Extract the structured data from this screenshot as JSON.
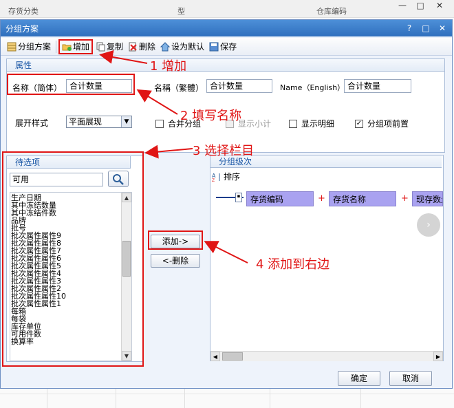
{
  "background": {
    "columns": [
      "存货分类",
      "型",
      "仓库编码"
    ],
    "window_buttons": [
      "—",
      "□",
      "✕"
    ]
  },
  "dialog": {
    "title": "分组方案",
    "title_buttons": [
      "?",
      "□",
      "✕"
    ]
  },
  "toolbar": {
    "scheme": "分组方案",
    "add": "增加",
    "copy": "复制",
    "delete": "删除",
    "set_default": "设为默认",
    "save": "保存"
  },
  "properties": {
    "tab": "属性",
    "name_simplified_label": "名称（简体）",
    "name_simplified_value": "合计数量",
    "name_traditional_label": "名稱（繁體）",
    "name_traditional_value": "合计数量",
    "name_english_label": "Name（English）",
    "name_english_value": "合计数量",
    "expand_style_label": "展开样式",
    "expand_style_value": "平面展现",
    "checkboxes": [
      {
        "label": "合并分组",
        "checked": false,
        "disabled": false
      },
      {
        "label": "显示小计",
        "checked": false,
        "disabled": true
      },
      {
        "label": "显示明细",
        "checked": false,
        "disabled": false
      },
      {
        "label": "分组项前置",
        "checked": true,
        "disabled": false
      }
    ]
  },
  "candidates": {
    "tab": "待选项",
    "search_value": "可用",
    "items": [
      "生产日期",
      "其中冻结数量",
      "其中冻结件数",
      "品牌",
      "批号",
      "批次属性属性9",
      "批次属性属性8",
      "批次属性属性7",
      "批次属性属性6",
      "批次属性属性5",
      "批次属性属性4",
      "批次属性属性3",
      "批次属性属性2",
      "批次属性属性10",
      "批次属性属性1",
      "每箱",
      "每袋",
      "库存单位",
      "可用件数",
      "换算率"
    ]
  },
  "middle": {
    "add_button": "添加->",
    "remove_button": "<-删除"
  },
  "group_levels": {
    "tab": "分组级次",
    "sort_label": "排序",
    "nodes": [
      "存货编码",
      "存货名称",
      "现存数量"
    ],
    "plus": "+"
  },
  "footer": {
    "ok": "确定",
    "cancel": "取消"
  },
  "annotations": {
    "step1": "1 增加",
    "step2": "2 填写名称",
    "step3": "3 选择栏目",
    "step4": "4 添加到右边",
    "color": "#e01515"
  }
}
